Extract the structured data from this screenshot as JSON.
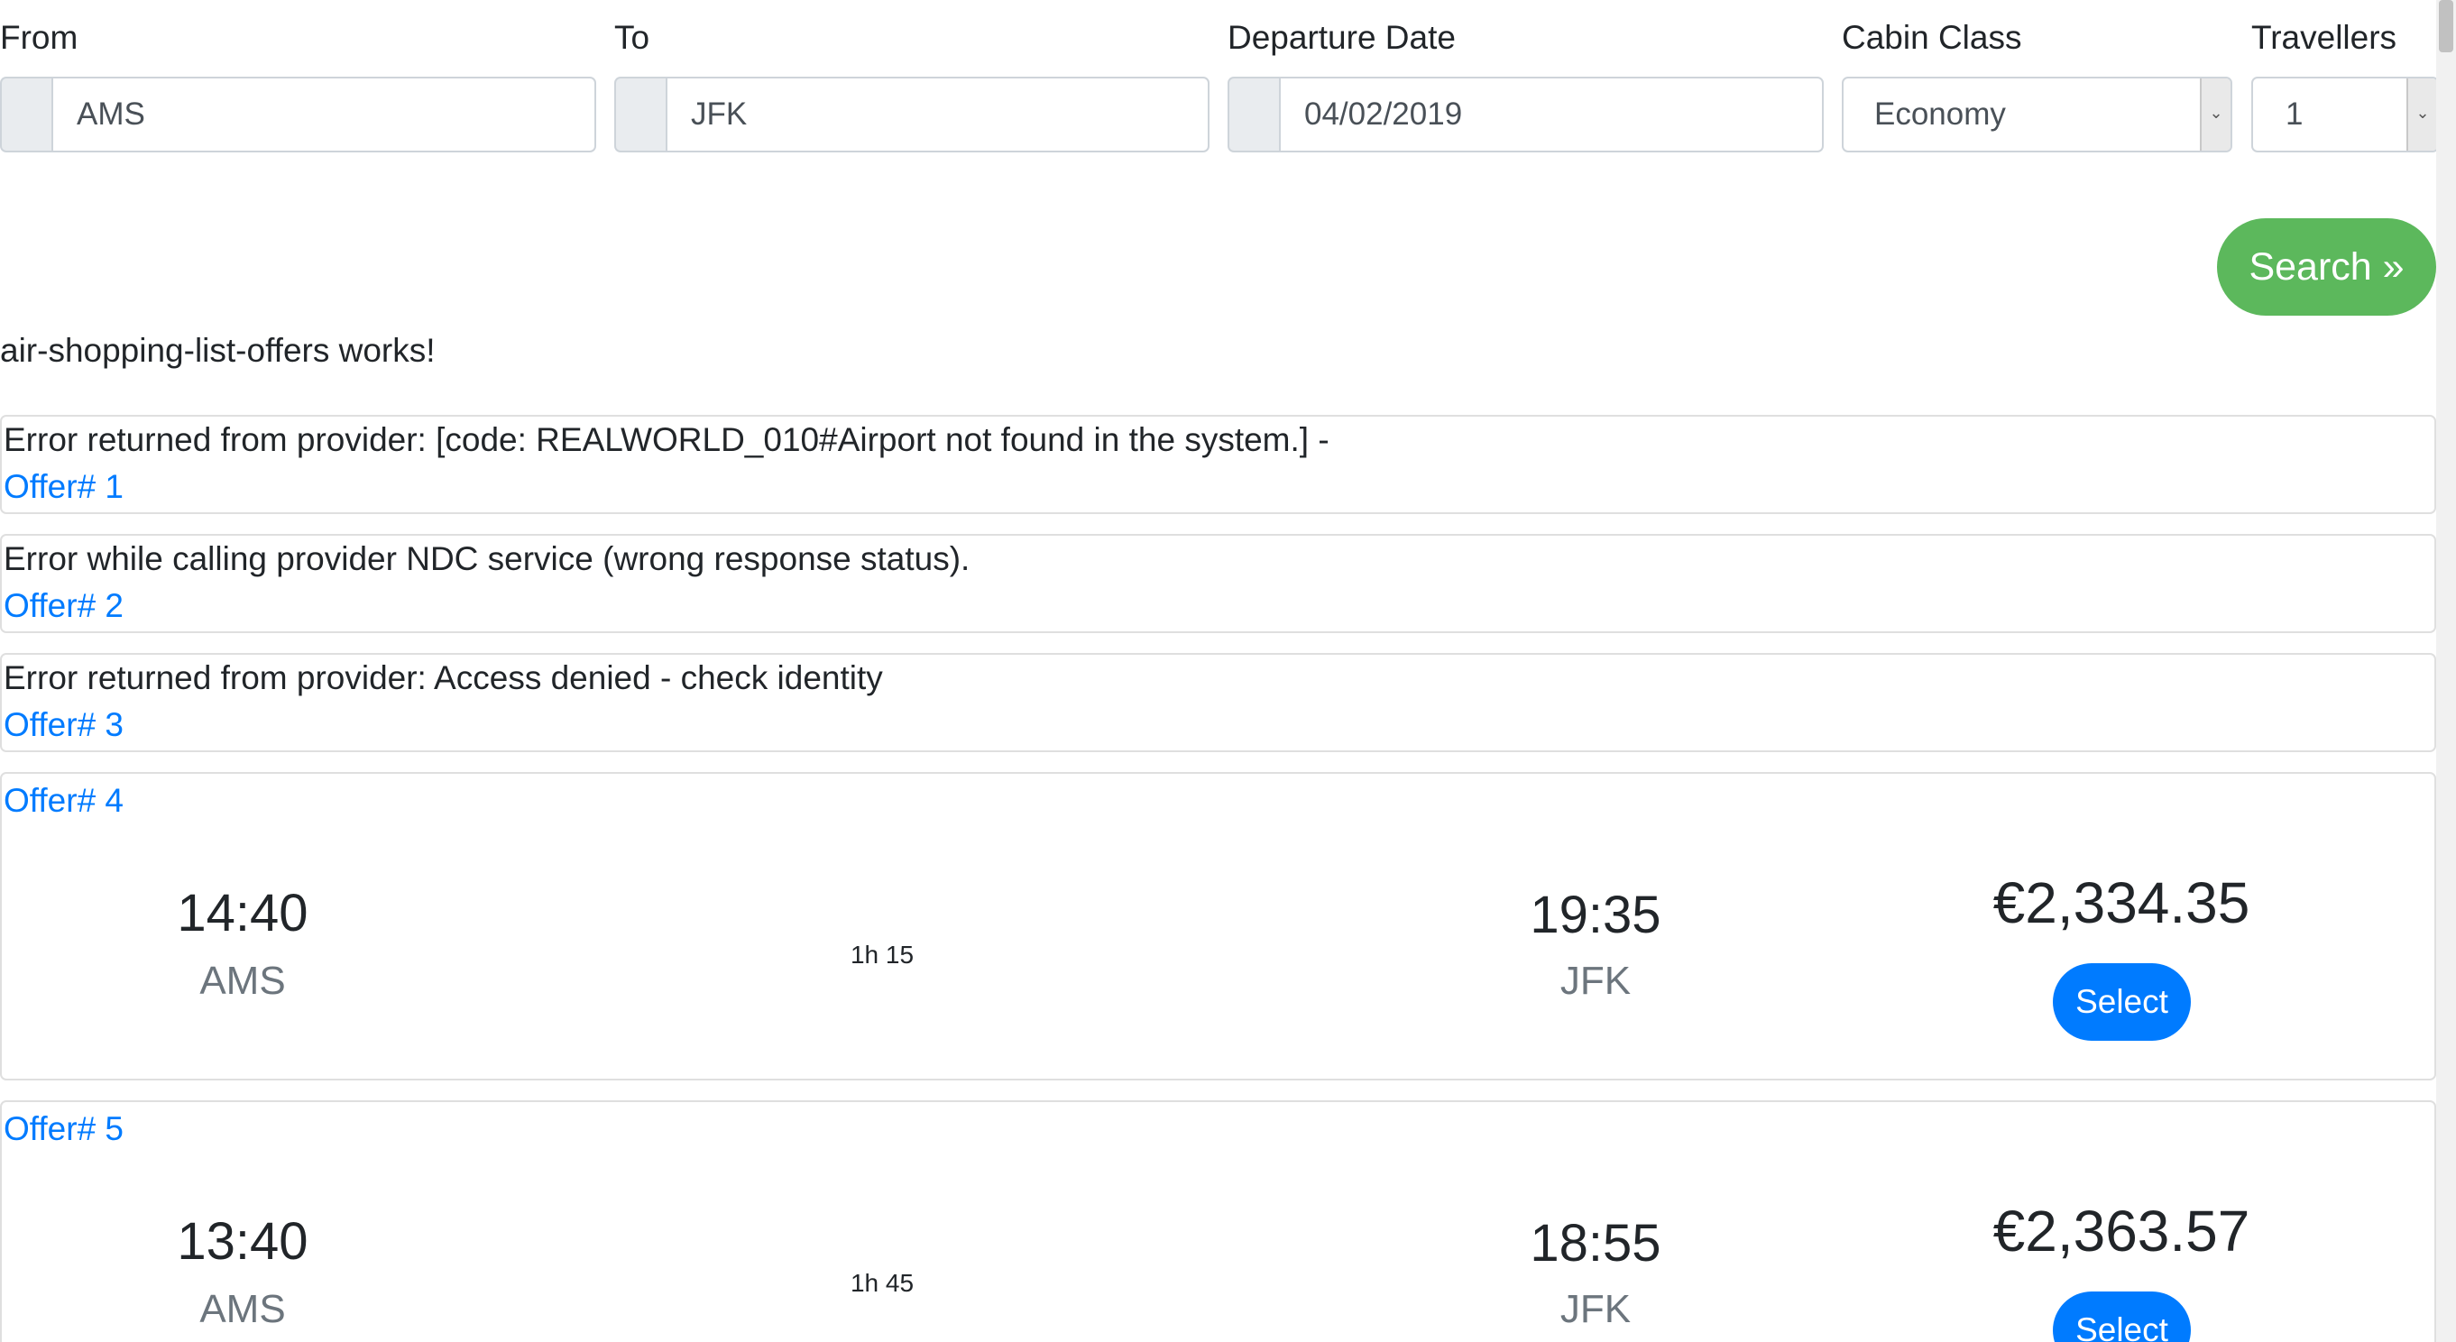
{
  "search_form": {
    "from": {
      "label": "From",
      "value": "AMS"
    },
    "to": {
      "label": "To",
      "value": "JFK"
    },
    "departure_date": {
      "label": "Departure Date",
      "value": "04/02/2019"
    },
    "cabin_class": {
      "label": "Cabin Class",
      "value": "Economy"
    },
    "travellers": {
      "label": "Travellers",
      "value": "1"
    },
    "search_label": "Search »"
  },
  "status_text": "air-shopping-list-offers works!",
  "error_offers": [
    {
      "message": "Error returned from provider: [code: REALWORLD_010#Airport not found in the system.] -",
      "title": "Offer# 1"
    },
    {
      "message": "Error while calling provider NDC service (wrong response status).",
      "title": "Offer# 2"
    },
    {
      "message": "Error returned from provider: Access denied - check identity",
      "title": "Offer# 3"
    }
  ],
  "flight_offers": [
    {
      "title": "Offer# 4",
      "departure_time": "14:40",
      "departure_code": "AMS",
      "duration": "1h 15",
      "arrival_time": "19:35",
      "arrival_code": "JFK",
      "price": "€2,334.35",
      "select_label": "Select"
    },
    {
      "title": "Offer# 5",
      "departure_time": "13:40",
      "departure_code": "AMS",
      "duration": "1h 45",
      "arrival_time": "18:55",
      "arrival_code": "JFK",
      "price": "€2,363.57",
      "select_label": "Select"
    }
  ],
  "colors": {
    "search_button": "#5cb85c",
    "select_button": "#007bff",
    "link": "#007bff"
  }
}
